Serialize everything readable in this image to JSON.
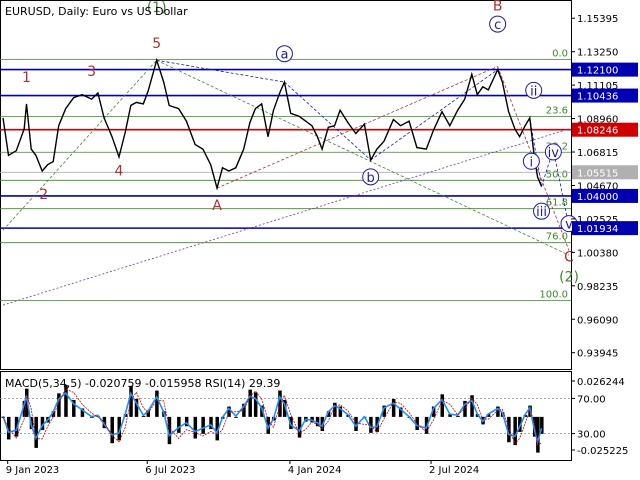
{
  "header": {
    "symbol": "EURUSD",
    "timeframe": "Daily",
    "description": "Euro vs US Dollar"
  },
  "chart_data": {
    "type": "line",
    "symbol": "EURUSD",
    "timeframe": "Daily",
    "price_axis": {
      "ticks": [
        "1.15395",
        "1.13250",
        "1.11105",
        "1.08960",
        "1.06815",
        "1.04670",
        "1.02525",
        "1.00380",
        "0.98235",
        "0.96090",
        "0.93945"
      ],
      "ylim": [
        0.929,
        1.165
      ]
    },
    "date_axis": {
      "ticks": [
        "9 Jan 2023",
        "6 Jul 2023",
        "4 Jan 2024",
        "2 Jul 2024"
      ],
      "range": [
        "2023-01-03",
        "2024-11-20"
      ]
    },
    "grid": false,
    "series": [
      {
        "name": "EURUSD",
        "color": "#000000",
        "points": [
          [
            "2023-01-03",
            1.09
          ],
          [
            "2023-01-10",
            1.066
          ],
          [
            "2023-01-20",
            1.069
          ],
          [
            "2023-01-30",
            1.083
          ],
          [
            "2023-02-02",
            1.099
          ],
          [
            "2023-02-08",
            1.07
          ],
          [
            "2023-02-14",
            1.066
          ],
          [
            "2023-02-22",
            1.056
          ],
          [
            "2023-03-01",
            1.06
          ],
          [
            "2023-03-08",
            1.062
          ],
          [
            "2023-03-15",
            1.085
          ],
          [
            "2023-03-24",
            1.096
          ],
          [
            "2023-04-03",
            1.103
          ],
          [
            "2023-04-14",
            1.105
          ],
          [
            "2023-04-26",
            1.102
          ],
          [
            "2023-05-04",
            1.106
          ],
          [
            "2023-05-12",
            1.09
          ],
          [
            "2023-05-22",
            1.078
          ],
          [
            "2023-05-31",
            1.065
          ],
          [
            "2023-06-08",
            1.081
          ],
          [
            "2023-06-15",
            1.098
          ],
          [
            "2023-06-22",
            1.1
          ],
          [
            "2023-07-01",
            1.099
          ],
          [
            "2023-07-07",
            1.107
          ],
          [
            "2023-07-18",
            1.127
          ],
          [
            "2023-07-27",
            1.113
          ],
          [
            "2023-08-03",
            1.098
          ],
          [
            "2023-08-15",
            1.096
          ],
          [
            "2023-08-25",
            1.088
          ],
          [
            "2023-09-05",
            1.073
          ],
          [
            "2023-09-15",
            1.07
          ],
          [
            "2023-09-25",
            1.06
          ],
          [
            "2023-10-03",
            1.045
          ],
          [
            "2023-10-10",
            1.058
          ],
          [
            "2023-10-18",
            1.056
          ],
          [
            "2023-10-27",
            1.058
          ],
          [
            "2023-11-06",
            1.07
          ],
          [
            "2023-11-14",
            1.087
          ],
          [
            "2023-11-21",
            1.096
          ],
          [
            "2023-11-29",
            1.099
          ],
          [
            "2023-12-07",
            1.078
          ],
          [
            "2023-12-14",
            1.095
          ],
          [
            "2023-12-22",
            1.106
          ],
          [
            "2023-12-28",
            1.113
          ],
          [
            "2024-01-05",
            1.093
          ],
          [
            "2024-01-16",
            1.091
          ],
          [
            "2024-01-24",
            1.088
          ],
          [
            "2024-02-01",
            1.085
          ],
          [
            "2024-02-08",
            1.078
          ],
          [
            "2024-02-14",
            1.07
          ],
          [
            "2024-02-22",
            1.084
          ],
          [
            "2024-03-01",
            1.085
          ],
          [
            "2024-03-08",
            1.095
          ],
          [
            "2024-03-18",
            1.087
          ],
          [
            "2024-03-28",
            1.08
          ],
          [
            "2024-04-08",
            1.086
          ],
          [
            "2024-04-16",
            1.063
          ],
          [
            "2024-04-24",
            1.07
          ],
          [
            "2024-05-03",
            1.075
          ],
          [
            "2024-05-15",
            1.089
          ],
          [
            "2024-05-24",
            1.085
          ],
          [
            "2024-06-04",
            1.088
          ],
          [
            "2024-06-14",
            1.071
          ],
          [
            "2024-06-26",
            1.07
          ],
          [
            "2024-07-05",
            1.082
          ],
          [
            "2024-07-16",
            1.094
          ],
          [
            "2024-07-26",
            1.085
          ],
          [
            "2024-08-05",
            1.095
          ],
          [
            "2024-08-14",
            1.102
          ],
          [
            "2024-08-23",
            1.118
          ],
          [
            "2024-08-30",
            1.105
          ],
          [
            "2024-09-06",
            1.11
          ],
          [
            "2024-09-13",
            1.108
          ],
          [
            "2024-09-25",
            1.121
          ],
          [
            "2024-10-01",
            1.113
          ],
          [
            "2024-10-09",
            1.094
          ],
          [
            "2024-10-17",
            1.083
          ],
          [
            "2024-10-23",
            1.078
          ],
          [
            "2024-10-30",
            1.085
          ],
          [
            "2024-11-05",
            1.09
          ],
          [
            "2024-11-11",
            1.064
          ],
          [
            "2024-11-15",
            1.052
          ],
          [
            "2024-11-20",
            1.046
          ]
        ]
      }
    ],
    "horizontal_levels": [
      {
        "price": 1.121,
        "label": "1.12100",
        "color": "#0000b0"
      },
      {
        "price": 1.10436,
        "label": "1.10436",
        "color": "#0000b0"
      },
      {
        "price": 1.08246,
        "label": "1.08246",
        "color": "#d00000"
      },
      {
        "price": 1.05515,
        "label": "1.05515",
        "color": "#b0b0b0"
      },
      {
        "price": 1.04,
        "label": "1.04000",
        "color": "#0000b0"
      },
      {
        "price": 1.01934,
        "label": "1.01934",
        "color": "#0000b0"
      }
    ],
    "fibonacci": {
      "color": "#3a8a2a",
      "from_date": "2023-07-18",
      "to_date": "2024-11-20",
      "levels": [
        {
          "ratio": "0.0",
          "price": 1.1275
        },
        {
          "ratio": "23.6",
          "price": 1.091
        },
        {
          "ratio": "38.2",
          "price": 1.068
        },
        {
          "ratio": "50.0",
          "price": 1.05
        },
        {
          "ratio": "61.8",
          "price": 1.0318
        },
        {
          "ratio": "76.0",
          "price": 1.01
        },
        {
          "ratio": "100.0",
          "price": 0.973
        }
      ]
    },
    "wave_labels": [
      {
        "text": "1",
        "date": "2023-02-02",
        "price": 1.113,
        "color": "#b03030"
      },
      {
        "text": "2",
        "date": "2023-02-24",
        "price": 1.038,
        "color": "#b03030"
      },
      {
        "text": "3",
        "date": "2023-04-26",
        "price": 1.117,
        "color": "#b03030"
      },
      {
        "text": "4",
        "date": "2023-05-31",
        "price": 1.053,
        "color": "#b03030"
      },
      {
        "text": "5",
        "date": "2023-07-18",
        "price": 1.135,
        "color": "#b03030"
      },
      {
        "text": "(1)",
        "date": "2023-07-18",
        "price": 1.158,
        "color": "#3a8a2a"
      },
      {
        "text": "A",
        "date": "2023-10-03",
        "price": 1.031,
        "color": "#b03030"
      },
      {
        "text": "B",
        "date": "2024-09-25",
        "price": 1.159,
        "color": "#b03030"
      },
      {
        "text": "C",
        "date": "2024-12-25",
        "price": 0.998,
        "color": "#b03030"
      },
      {
        "text": "(2)",
        "date": "2024-12-25",
        "price": 0.985,
        "color": "#3a8a2a"
      },
      {
        "text": "a",
        "date": "2023-12-28",
        "price": 1.128,
        "color": "#1a1ab0"
      },
      {
        "text": "b",
        "date": "2024-04-16",
        "price": 1.049,
        "color": "#1a1ab0"
      },
      {
        "text": "c",
        "date": "2024-09-25",
        "price": 1.147,
        "color": "#1a1ab0"
      },
      {
        "text": "i",
        "date": "2024-11-07",
        "price": 1.059,
        "color": "#1a1ab0"
      },
      {
        "text": "ii",
        "date": "2024-11-10",
        "price": 1.1045,
        "color": "#1a1ab0"
      },
      {
        "text": "iii",
        "date": "2024-11-20",
        "price": 1.027,
        "color": "#1a1ab0"
      },
      {
        "text": "iv",
        "date": "2024-12-05",
        "price": 1.065,
        "color": "#1a1ab0"
      },
      {
        "text": "v",
        "date": "2024-12-25",
        "price": 1.019,
        "color": "#1a1ab0"
      }
    ],
    "indicator": {
      "label": "MACD(5,34,5) -0.020759 -0.015958 RSI(14) 29.39",
      "name_macd": "MACD(5,34,5)",
      "macd_main": -0.020759,
      "macd_signal": -0.015958,
      "name_rsi": "RSI(14)",
      "rsi": 29.39,
      "axis_ticks": [
        "0.026244",
        "70.00",
        "30.00",
        "-0.025225"
      ],
      "macd_range": [
        -0.025225,
        0.026244
      ],
      "rsi_range": [
        0,
        100
      ],
      "rsi_levels": [
        70,
        30
      ],
      "colors": {
        "histogram": "#000000",
        "rsi": "#1e90ff",
        "signal": "#d00000"
      }
    }
  }
}
